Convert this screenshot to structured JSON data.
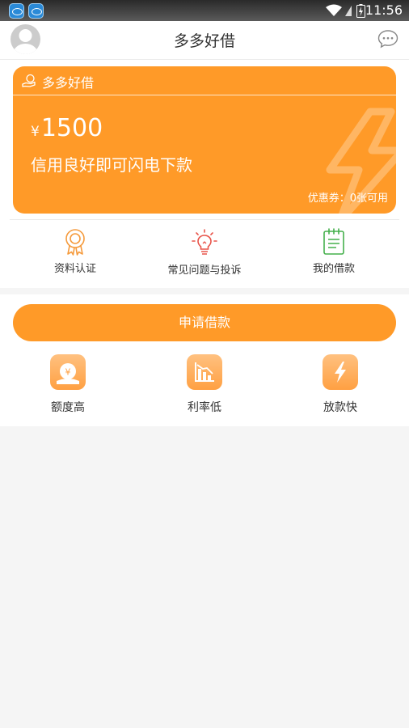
{
  "status_bar": {
    "time": "11:56"
  },
  "header": {
    "title": "多多好借"
  },
  "card": {
    "brand": "多多好借",
    "currency": "¥",
    "amount": "1500",
    "slogan": "信用良好即可闪电下款",
    "coupon": "优惠券：0张可用"
  },
  "menu": {
    "items": [
      {
        "label": "资料认证",
        "icon": "certificate-icon"
      },
      {
        "label": "常见问题与投诉",
        "icon": "lightbulb-icon"
      },
      {
        "label": "我的借款",
        "icon": "notepad-icon"
      }
    ]
  },
  "apply_button": {
    "label": "申请借款"
  },
  "features": [
    {
      "label": "额度高",
      "icon": "money-bag-icon"
    },
    {
      "label": "利率低",
      "icon": "chart-down-icon"
    },
    {
      "label": "放款快",
      "icon": "lightning-icon"
    }
  ],
  "colors": {
    "accent": "#ff9a28",
    "accent_light": "#ffc180",
    "text": "#333333",
    "background": "#f5f5f5"
  }
}
